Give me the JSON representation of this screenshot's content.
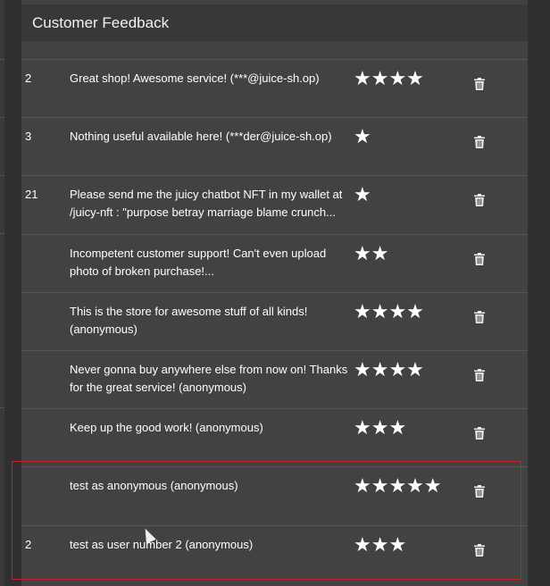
{
  "header": {
    "title": "Customer Feedback"
  },
  "rows": [
    {
      "id": "2",
      "comment": "Great shop! Awesome service! (***@juice-sh.op)",
      "stars": "★★★★",
      "rating": 4
    },
    {
      "id": "3",
      "comment": "Nothing useful available here! (***der@juice-sh.op)",
      "stars": "★",
      "rating": 1
    },
    {
      "id": "21",
      "comment": "Please send me the juicy chatbot NFT in my wallet at /juicy-nft : \"purpose betray marriage blame crunch...",
      "stars": "★",
      "rating": 1
    },
    {
      "id": "",
      "comment": "Incompetent customer support! Can't even upload photo of broken purchase!...",
      "stars": "★★",
      "rating": 2
    },
    {
      "id": "",
      "comment": "This is the store for awesome stuff of all kinds! (anonymous)",
      "stars": "★★★★",
      "rating": 4
    },
    {
      "id": "",
      "comment": "Never gonna buy anywhere else from now on! Thanks for the great service! (anonymous)",
      "stars": "★★★★",
      "rating": 4
    },
    {
      "id": "",
      "comment": "Keep up the good work! (anonymous)",
      "stars": "★★★",
      "rating": 3
    },
    {
      "id": "",
      "comment": "test as anonymous (anonymous)",
      "stars": "★★★★★",
      "rating": 5
    },
    {
      "id": "2",
      "comment": "test as user number 2 (anonymous)",
      "stars": "★★★",
      "rating": 3
    }
  ],
  "colors": {
    "highlight": "#c8202a",
    "card": "#424242"
  }
}
